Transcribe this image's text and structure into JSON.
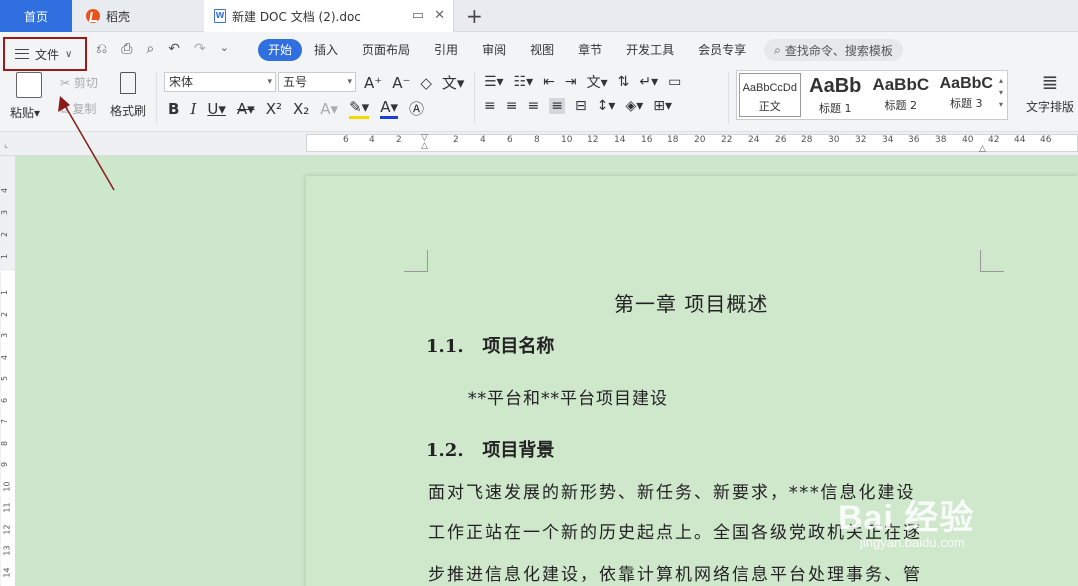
{
  "tabs": {
    "home": "首页",
    "daoke": "稻壳",
    "doc_title": "新建 DOC 文档 (2).doc"
  },
  "menu": {
    "file": "文件",
    "tabs": [
      "开始",
      "插入",
      "页面布局",
      "引用",
      "审阅",
      "视图",
      "章节",
      "开发工具",
      "会员专享"
    ],
    "search_placeholder": "查找命令、搜索模板"
  },
  "toolbar": {
    "paste": "粘贴",
    "cut": "剪切",
    "copy": "复制",
    "format_painter": "格式刷",
    "font_name": "宋体",
    "font_size": "五号",
    "text_layout": "文字排版"
  },
  "styles": [
    {
      "sample": "AaBbCcDd",
      "name": "正文"
    },
    {
      "sample": "AaBb",
      "name": "标题 1"
    },
    {
      "sample": "AaBbC",
      "name": "标题 2"
    },
    {
      "sample": "AaBbC",
      "name": "标题 3"
    }
  ],
  "ruler": {
    "h_ticks": [
      "6",
      "4",
      "2",
      "2",
      "4",
      "6",
      "8",
      "10",
      "12",
      "14",
      "16",
      "18",
      "20",
      "22",
      "24",
      "26",
      "28",
      "30",
      "32",
      "34",
      "36",
      "38",
      "40",
      "42",
      "44",
      "46"
    ],
    "v_ticks_top": [
      "4",
      "3",
      "2",
      "1"
    ],
    "v_ticks_bottom": [
      "1",
      "2",
      "3",
      "4",
      "5",
      "6",
      "7",
      "8",
      "9",
      "10",
      "11",
      "12",
      "13",
      "14",
      "15"
    ]
  },
  "document": {
    "chapter": "第一章  项目概述",
    "h1_num": "1.1.",
    "h1_title": "项目名称",
    "p1": "**平台和**平台项目建设",
    "h2_num": "1.2.",
    "h2_title": "项目背景",
    "p2_line1": "面对飞速发展的新形势、新任务、新要求，***信息化建设",
    "p2_line2": "工作正站在一个新的历史起点上。全国各级党政机关正在逐",
    "p2_line3": "步推进信息化建设，依靠计算机网络信息平台处理事务、管"
  },
  "watermark": {
    "text": "Bai 经验",
    "url": "jingyan.baidu.com"
  },
  "colors": {
    "accent": "#2f6fe0",
    "highlight_box": "#9b1b1b",
    "page_bg": "#cfe8cc"
  }
}
